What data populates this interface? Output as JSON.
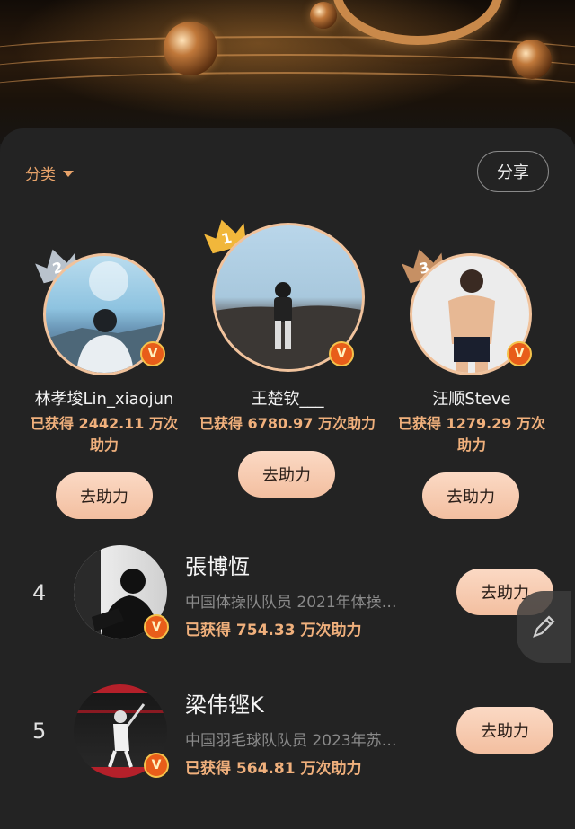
{
  "header": {
    "category_label": "分类",
    "share_label": "分享"
  },
  "podium": [
    {
      "rank": "1",
      "name": "王楚钦___",
      "stat_line1": "已获得 6780.97 万次助力",
      "button": "去助力",
      "badge": "V"
    },
    {
      "rank": "2",
      "name": "林孝埈Lin_xiaojun",
      "stat_line1": "已获得 2442.11 万次",
      "stat_line2": "助力",
      "button": "去助力",
      "badge": "V"
    },
    {
      "rank": "3",
      "name": "汪顺Steve",
      "stat_line1": "已获得 1279.29 万次",
      "stat_line2": "助力",
      "button": "去助力",
      "badge": "V"
    }
  ],
  "list": [
    {
      "rank": "4",
      "name": "張博恆",
      "desc": "中国体操队队员 2021年体操…",
      "stat_prefix": "已获得 ",
      "stat_value": "754.33",
      "stat_suffix": " 万次助力",
      "button": "去助力",
      "badge": "V"
    },
    {
      "rank": "5",
      "name": "梁伟铿K",
      "desc": "中国羽毛球队队员 2023年苏…",
      "stat_prefix": "已获得 ",
      "stat_value": "564.81",
      "stat_suffix": " 万次助力",
      "button": "去助力",
      "badge": "V"
    }
  ],
  "colors": {
    "accent": "#f0b07c",
    "button_bg": "#f7cdb2",
    "badge": "#e85d1a",
    "gold": "#f1b73b",
    "silver": "#b9c2cc",
    "bronze": "#c69064"
  },
  "icons": {
    "edit": "pencil-icon",
    "caret": "caret-down-icon",
    "badge": "verified-v-icon"
  }
}
